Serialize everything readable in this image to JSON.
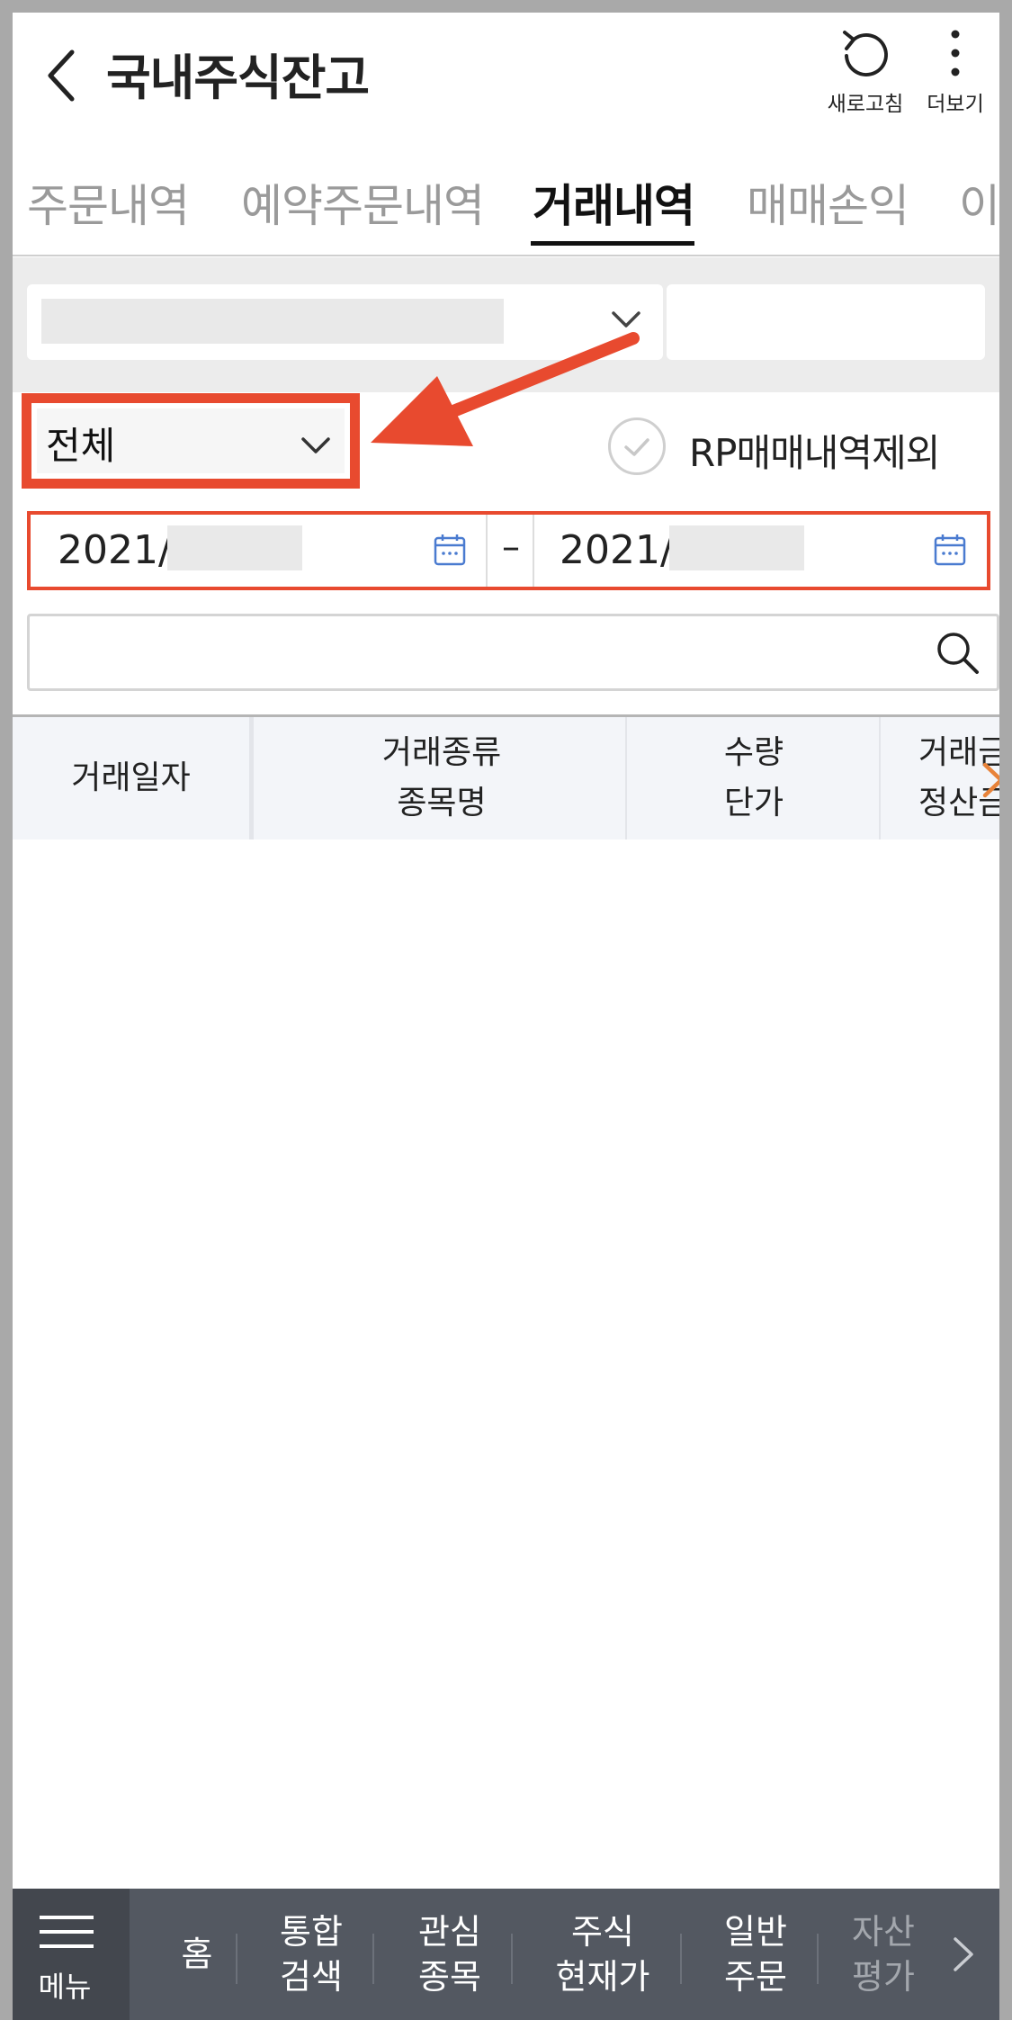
{
  "header": {
    "title": "국내주식잔고",
    "refresh_label": "새로고침",
    "more_label": "더보기"
  },
  "tabs": [
    {
      "label": "주문내역",
      "active": false
    },
    {
      "label": "예약주문내역",
      "active": false
    },
    {
      "label": "거래내역",
      "active": true
    },
    {
      "label": "매매손익",
      "active": false
    },
    {
      "label": "이",
      "active": false
    }
  ],
  "filters": {
    "type_select": "전체",
    "rp_exclude_label": "RP매매내역제외",
    "date_start": "2021/",
    "date_separator": "–",
    "date_end": "2021/",
    "search_placeholder": ""
  },
  "table": {
    "columns": [
      {
        "line1": "거래일자",
        "line2": ""
      },
      {
        "line1": "거래종류",
        "line2": "종목명"
      },
      {
        "line1": "수량",
        "line2": "단가"
      },
      {
        "line1": "거래금",
        "line2": "정산금"
      }
    ]
  },
  "bottom_nav": {
    "menu_label": "메뉴",
    "items": [
      {
        "line1": "홈",
        "line2": ""
      },
      {
        "line1": "통합",
        "line2": "검색"
      },
      {
        "line1": "관심",
        "line2": "종목"
      },
      {
        "line1": "주식",
        "line2": "현재가"
      },
      {
        "line1": "일반",
        "line2": "주문"
      },
      {
        "line1": "자산",
        "line2": "평가"
      }
    ]
  },
  "colors": {
    "highlight": "#e84a2f",
    "nav_bg": "#535861",
    "calendar_icon": "#4a7bd0",
    "table_header_bg": "#f3f5f9"
  },
  "icons": [
    "back-arrow-icon",
    "refresh-icon",
    "more-vertical-icon",
    "chevron-down-icon",
    "check-circle-icon",
    "calendar-icon",
    "search-icon",
    "chevron-right-icon",
    "hamburger-menu-icon"
  ]
}
